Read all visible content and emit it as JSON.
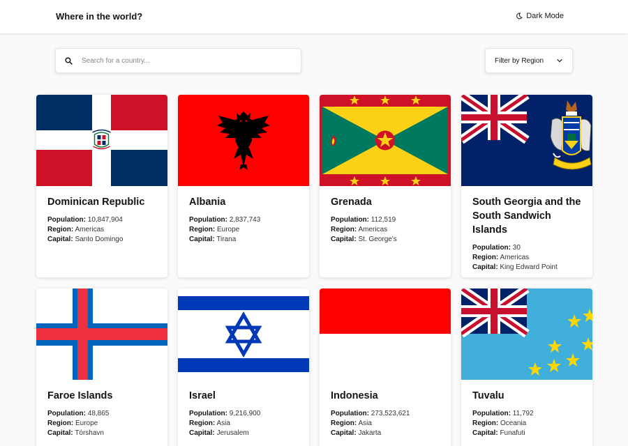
{
  "header": {
    "title": "Where in the world?",
    "mode_label": "Dark Mode"
  },
  "search": {
    "placeholder": "Search for a country...",
    "value": ""
  },
  "filter": {
    "label": "Filter by Region"
  },
  "labels": {
    "population": "Population:",
    "region": "Region:",
    "capital": "Capital:"
  },
  "countries": [
    {
      "name": "Dominican Republic",
      "population": "10,847,904",
      "region": "Americas",
      "capital": "Santo Domingo",
      "flag": "dominican-republic"
    },
    {
      "name": "Albania",
      "population": "2,837,743",
      "region": "Europe",
      "capital": "Tirana",
      "flag": "albania"
    },
    {
      "name": "Grenada",
      "population": "112,519",
      "region": "Americas",
      "capital": "St. George's",
      "flag": "grenada"
    },
    {
      "name": "South Georgia and the South Sandwich Islands",
      "population": "30",
      "region": "Americas",
      "capital": "King Edward Point",
      "flag": "south-georgia"
    },
    {
      "name": "Faroe Islands",
      "population": "48,865",
      "region": "Europe",
      "capital": "Tórshavn",
      "flag": "faroe-islands"
    },
    {
      "name": "Israel",
      "population": "9,216,900",
      "region": "Asia",
      "capital": "Jerusalem",
      "flag": "israel"
    },
    {
      "name": "Indonesia",
      "population": "273,523,621",
      "region": "Asia",
      "capital": "Jakarta",
      "flag": "indonesia"
    },
    {
      "name": "Tuvalu",
      "population": "11,792",
      "region": "Oceania",
      "capital": "Funafuti",
      "flag": "tuvalu"
    }
  ]
}
